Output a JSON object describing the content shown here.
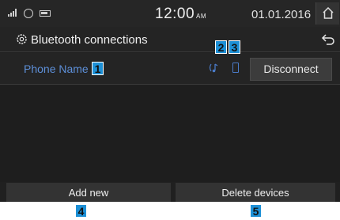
{
  "status_bar": {
    "icons": [
      "signal-icon",
      "bluetooth-audio-icon",
      "battery-icon"
    ],
    "time": "12:00",
    "ampm": "AM",
    "date": "01.01.2016",
    "home_icon": "home-icon"
  },
  "title_bar": {
    "title": "Bluetooth connections",
    "icon": "gear-icon",
    "back_icon": "back-arrow-icon"
  },
  "device": {
    "name": "Phone Name",
    "icons": [
      "bluetooth-audio-icon",
      "phone-icon"
    ],
    "disconnect_label": "Disconnect"
  },
  "bottom_buttons": {
    "add_new": "Add new",
    "delete_devices": "Delete devices"
  },
  "callouts": [
    "1",
    "2",
    "3",
    "4",
    "5"
  ],
  "colors": {
    "background": "#202020",
    "device_name": "#5d8fd8",
    "callout": "#1d90d6"
  }
}
